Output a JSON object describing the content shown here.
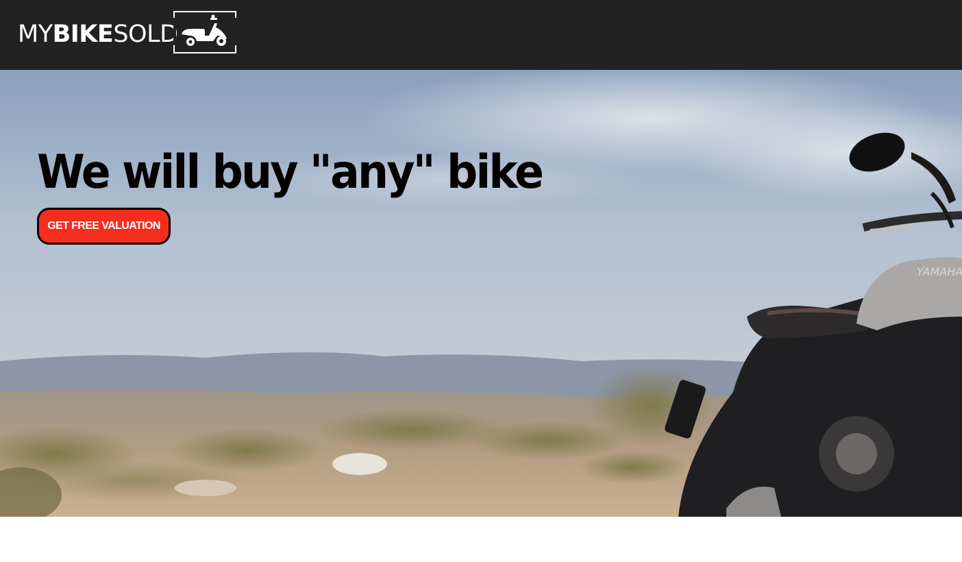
{
  "header": {
    "logo": {
      "text_light_1": "MY",
      "text_bold": "BIKE",
      "text_light_2": "SOLD",
      "icon": "scooter-icon"
    }
  },
  "hero": {
    "title": "We will buy \"any\" bike",
    "cta_label": "GET FREE VALUATION",
    "background": "motorcycle-on-desert-landscape-photo"
  },
  "colors": {
    "header_bg": "#222222",
    "cta_bg": "#f52d1f",
    "cta_border": "#000000",
    "title": "#000000"
  }
}
